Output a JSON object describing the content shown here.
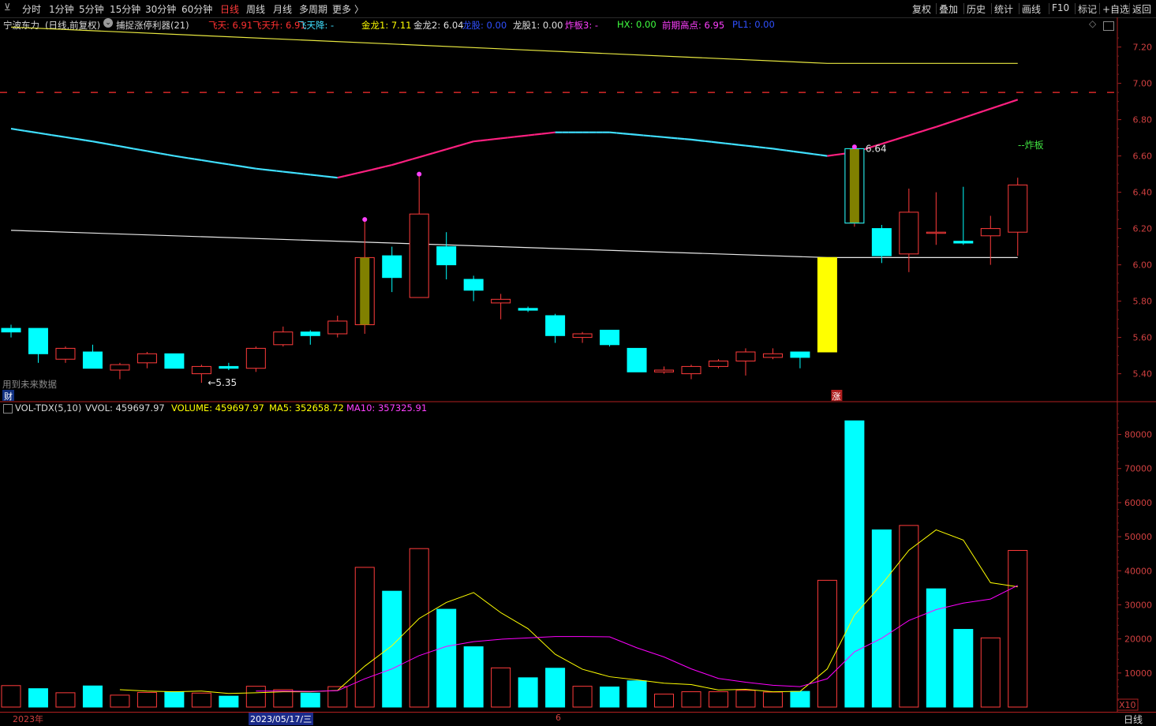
{
  "toolbar": {
    "periods": [
      "分时",
      "1分钟",
      "5分钟",
      "15分钟",
      "30分钟",
      "60分钟",
      "日线",
      "周线",
      "月线",
      "多周期",
      "更多"
    ],
    "more_arrow": "〉",
    "active_period": "日线",
    "right_buttons": [
      "复权",
      "叠加",
      "历史",
      "统计",
      "画线",
      "F10",
      "标记",
      "+自选",
      "返回"
    ]
  },
  "main_header": {
    "stock": "宁波东力",
    "chart_mode": "(日线,前复权)",
    "formula": "捕捉涨停利器(21)",
    "values": [
      {
        "text": "飞天: 6.91",
        "color": "#ff3030"
      },
      {
        "text": "飞天升: 6.91",
        "color": "#ff3030"
      },
      {
        "text": "飞天降: -",
        "color": "#40e0ff"
      },
      {
        "text": "金龙1: 7.11",
        "color": "#ffff00"
      },
      {
        "text": "金龙2: 6.04",
        "color": "#e0e0e0"
      },
      {
        "text": "龙股: 0.00",
        "color": "#3050ff"
      },
      {
        "text": "龙股1: 0.00",
        "color": "#e0e0e0"
      },
      {
        "text": "炸板3: -",
        "color": "#ff40ff"
      },
      {
        "text": "HX: 0.00",
        "color": "#40ff40"
      },
      {
        "text": "前期高点: 6.95",
        "color": "#ff40ff"
      },
      {
        "text": "PL1: 0.00",
        "color": "#3050ff"
      }
    ]
  },
  "vol_header": {
    "name": "VOL-TDX(5,10)",
    "vvol": "VVOL: 459697.97",
    "volume": "VOLUME: 459697.97",
    "ma5": "MA5: 352658.72",
    "ma10": "MA10: 357325.91"
  },
  "annotations": {
    "low_label": "←5.35",
    "high_label": "6.64",
    "zhaban_label": "--炸板",
    "future_data_note": "用到未来数据",
    "cai_badge": "财",
    "zhang_badge": "涨"
  },
  "price_axis": [
    "7.20",
    "7.00",
    "6.80",
    "6.60",
    "6.40",
    "6.20",
    "6.00",
    "5.80",
    "5.60",
    "5.40"
  ],
  "vol_axis": [
    "80000",
    "70000",
    "60000",
    "50000",
    "40000",
    "30000",
    "20000",
    "10000"
  ],
  "vol_axis_unit": "X10",
  "bottom_axis": {
    "year": "2023年",
    "cursor_date": "2023/05/17/三",
    "month": "6",
    "cycle": "日线"
  },
  "colors": {
    "up": "#ff3b3b",
    "down": "#00ffff",
    "background": "#000000",
    "ma5": "#ffff00",
    "ma10": "#ff00ff"
  },
  "chart_data": [
    {
      "type": "candlestick",
      "ylim": [
        5.32,
        7.32
      ],
      "candles": [
        {
          "o": 5.65,
          "h": 5.67,
          "l": 5.6,
          "c": 5.63
        },
        {
          "o": 5.65,
          "h": 5.65,
          "l": 5.46,
          "c": 5.51
        },
        {
          "o": 5.48,
          "h": 5.55,
          "l": 5.46,
          "c": 5.54
        },
        {
          "o": 5.52,
          "h": 5.56,
          "l": 5.43,
          "c": 5.43
        },
        {
          "o": 5.42,
          "h": 5.46,
          "l": 5.37,
          "c": 5.45
        },
        {
          "o": 5.46,
          "h": 5.52,
          "l": 5.43,
          "c": 5.51
        },
        {
          "o": 5.51,
          "h": 5.51,
          "l": 5.43,
          "c": 5.43
        },
        {
          "o": 5.4,
          "h": 5.45,
          "l": 5.35,
          "c": 5.44
        },
        {
          "o": 5.44,
          "h": 5.46,
          "l": 5.42,
          "c": 5.43
        },
        {
          "o": 5.43,
          "h": 5.55,
          "l": 5.41,
          "c": 5.54
        },
        {
          "o": 5.56,
          "h": 5.66,
          "l": 5.55,
          "c": 5.63
        },
        {
          "o": 5.63,
          "h": 5.64,
          "l": 5.56,
          "c": 5.61
        },
        {
          "o": 5.62,
          "h": 5.72,
          "l": 5.6,
          "c": 5.69
        },
        {
          "o": 5.67,
          "h": 6.25,
          "l": 5.62,
          "c": 6.04,
          "limit_up": true
        },
        {
          "o": 6.05,
          "h": 6.1,
          "l": 5.85,
          "c": 5.93
        },
        {
          "o": 5.82,
          "h": 6.5,
          "l": 5.82,
          "c": 6.28
        },
        {
          "o": 6.1,
          "h": 6.18,
          "l": 5.92,
          "c": 6.0
        },
        {
          "o": 5.92,
          "h": 5.94,
          "l": 5.8,
          "c": 5.86
        },
        {
          "o": 5.79,
          "h": 5.84,
          "l": 5.7,
          "c": 5.81
        },
        {
          "o": 5.76,
          "h": 5.77,
          "l": 5.74,
          "c": 5.75
        },
        {
          "o": 5.72,
          "h": 5.73,
          "l": 5.57,
          "c": 5.61
        },
        {
          "o": 5.6,
          "h": 5.63,
          "l": 5.57,
          "c": 5.62
        },
        {
          "o": 5.64,
          "h": 5.64,
          "l": 5.55,
          "c": 5.56
        },
        {
          "o": 5.54,
          "h": 5.54,
          "l": 5.41,
          "c": 5.41
        },
        {
          "o": 5.41,
          "h": 5.44,
          "l": 5.4,
          "c": 5.42
        },
        {
          "o": 5.4,
          "h": 5.45,
          "l": 5.37,
          "c": 5.44
        },
        {
          "o": 5.44,
          "h": 5.48,
          "l": 5.43,
          "c": 5.47
        },
        {
          "o": 5.47,
          "h": 5.54,
          "l": 5.39,
          "c": 5.52
        },
        {
          "o": 5.49,
          "h": 5.54,
          "l": 5.48,
          "c": 5.51
        },
        {
          "o": 5.52,
          "h": 5.52,
          "l": 5.43,
          "c": 5.49
        },
        {
          "o": 5.52,
          "h": 6.04,
          "l": 5.52,
          "c": 6.04,
          "limit_up": true,
          "zhang": true
        },
        {
          "o": 6.23,
          "h": 6.64,
          "l": 6.21,
          "c": 6.64,
          "limit_up": true
        },
        {
          "o": 6.2,
          "h": 6.22,
          "l": 6.01,
          "c": 6.05
        },
        {
          "o": 6.06,
          "h": 6.42,
          "l": 5.96,
          "c": 6.29
        },
        {
          "o": 6.18,
          "h": 6.4,
          "l": 6.11,
          "c": 6.18
        },
        {
          "o": 6.13,
          "h": 6.43,
          "l": 6.11,
          "c": 6.12
        },
        {
          "o": 6.16,
          "h": 6.27,
          "l": 6.0,
          "c": 6.2
        },
        {
          "o": 6.18,
          "h": 6.48,
          "l": 6.05,
          "c": 6.44
        }
      ],
      "lines": {
        "jinlong1_yellow": [
          [
            0,
            7.31
          ],
          [
            30,
            7.11
          ],
          [
            37,
            7.11
          ]
        ],
        "jinlong2_white": [
          [
            0,
            6.19
          ],
          [
            30,
            6.04
          ],
          [
            37,
            6.04
          ]
        ],
        "qianqi_gaodian_dashed": 6.95,
        "feitian": [
          [
            0,
            6.75
          ],
          [
            3,
            6.68
          ],
          [
            6,
            6.6
          ],
          [
            9,
            6.53
          ],
          [
            12,
            6.48
          ],
          [
            14,
            6.55
          ],
          [
            17,
            6.68
          ],
          [
            20,
            6.73
          ],
          [
            22,
            6.73
          ],
          [
            25,
            6.69
          ],
          [
            28,
            6.64
          ],
          [
            30,
            6.6
          ],
          [
            31,
            6.62
          ],
          [
            34,
            6.76
          ],
          [
            37,
            6.91
          ]
        ],
        "feitian_red_segments": [
          [
            12,
            20
          ],
          [
            30,
            37
          ]
        ]
      },
      "pink_markers": [
        {
          "i": 13,
          "v": 6.25
        },
        {
          "i": 15,
          "v": 6.5
        },
        {
          "i": 31,
          "v": 6.65
        }
      ]
    },
    {
      "type": "bar",
      "series": [
        {
          "name": "VOLUME",
          "values": [
            6300,
            5400,
            4200,
            6200,
            3500,
            4300,
            4500,
            4100,
            3200,
            6100,
            5100,
            4100,
            6000,
            41000,
            34000,
            46500,
            28700,
            17700,
            11500,
            8600,
            11400,
            6100,
            5900,
            7700,
            3800,
            4500,
            4500,
            4900,
            4400,
            4600,
            37200,
            84000,
            52000,
            53300,
            34700,
            22800,
            20300,
            45970
          ],
          "up": [
            true,
            false,
            true,
            false,
            true,
            true,
            false,
            true,
            false,
            true,
            true,
            false,
            true,
            true,
            false,
            true,
            false,
            false,
            true,
            false,
            false,
            true,
            false,
            false,
            true,
            true,
            true,
            true,
            true,
            false,
            true,
            false,
            false,
            true,
            false,
            false,
            true,
            true
          ]
        },
        {
          "name": "MA5",
          "values": [
            null,
            null,
            null,
            null,
            5100,
            4700,
            4500,
            4700,
            4000,
            4200,
            4500,
            4500,
            4900,
            12000,
            18000,
            26000,
            30700,
            33600,
            27700,
            23000,
            15500,
            11100,
            8900,
            8000,
            7000,
            6600,
            5000,
            5200,
            4500,
            4600,
            11200,
            27000,
            36000,
            46000,
            52000,
            49000,
            36500,
            35300
          ]
        },
        {
          "name": "MA10",
          "values": [
            null,
            null,
            null,
            null,
            null,
            null,
            null,
            null,
            null,
            4700,
            4700,
            4600,
            4800,
            8300,
            11200,
            15100,
            17800,
            19200,
            19900,
            20300,
            20700,
            20700,
            20600,
            17400,
            14700,
            11200,
            8400,
            7300,
            6400,
            6000,
            8300,
            16200,
            20200,
            25400,
            28600,
            30500,
            31700,
            35700
          ]
        }
      ],
      "ylim": [
        0,
        88000
      ]
    }
  ]
}
